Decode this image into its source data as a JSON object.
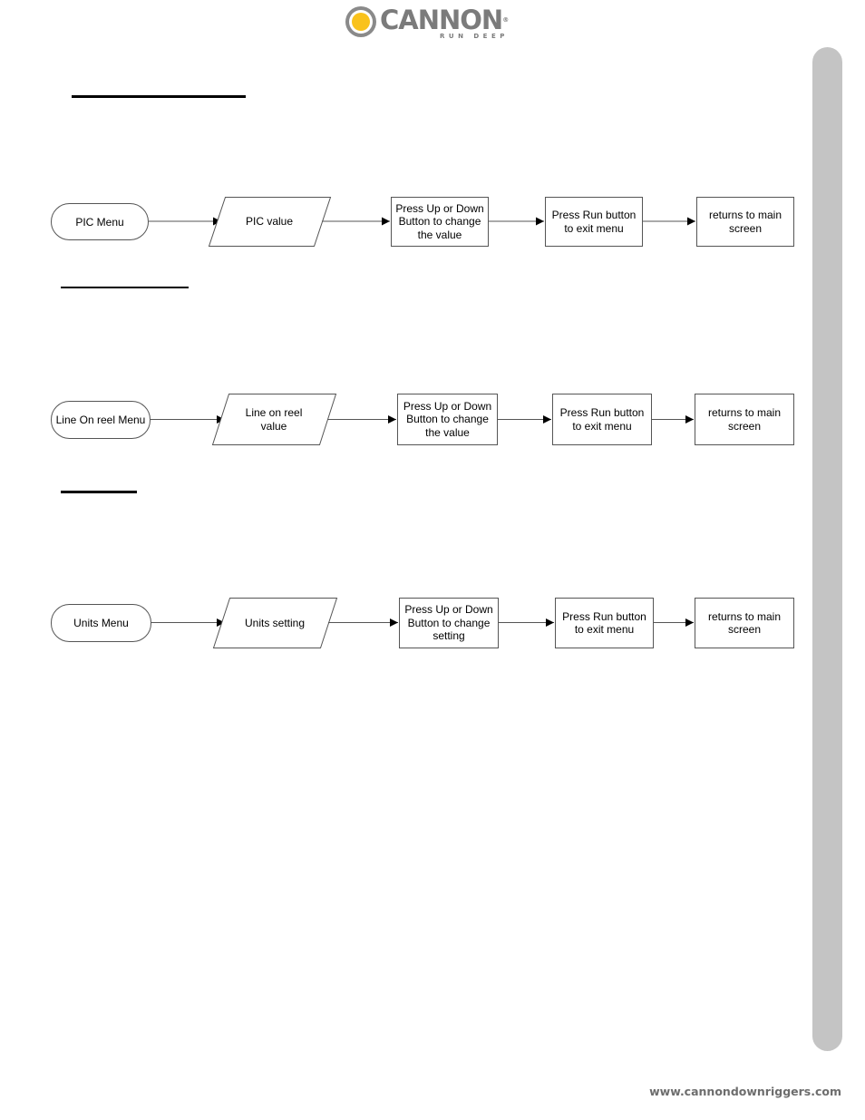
{
  "brand": {
    "name": "CANNON",
    "registered": "®",
    "tagline": "RUN DEEP",
    "colors": {
      "sun": "#f9c21c",
      "gray": "#7b7b7b",
      "side_tab": "#c4c4c4"
    }
  },
  "flowcharts": [
    {
      "start": "PIC Menu",
      "input": "PIC value",
      "process": "Press Up or Down Button to change the value",
      "exit": "Press Run button to exit menu",
      "end": "returns to main screen"
    },
    {
      "start": "Line On reel Menu",
      "input": "Line on reel value",
      "process": "Press Up or Down Button to change the value",
      "exit": "Press Run button to exit menu",
      "end": "returns to main screen"
    },
    {
      "start": "Units Menu",
      "input": "Units setting",
      "process": "Press Up or Down Button to change setting",
      "exit": "Press Run button to exit menu",
      "end": "returns to main screen"
    }
  ],
  "footer": {
    "url": "www.cannondownriggers.com"
  }
}
